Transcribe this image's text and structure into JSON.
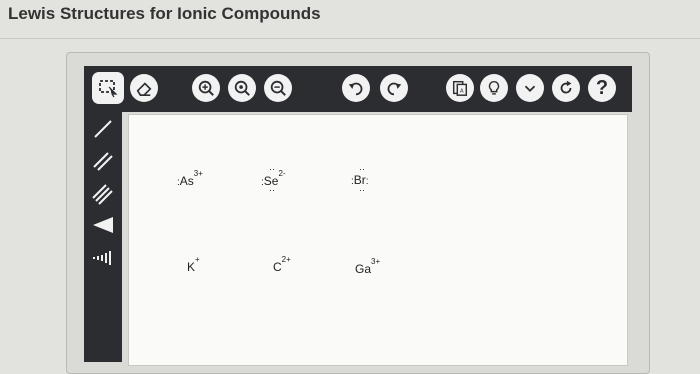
{
  "page": {
    "title": "Lewis Structures for Ionic Compounds"
  },
  "toolbar": {
    "buttons": [
      {
        "name": "select-tool",
        "icon": "lasso-select-icon"
      },
      {
        "name": "eraser-tool",
        "icon": "eraser-icon"
      },
      {
        "name": "zoom-fit",
        "icon": "zoom-plus-icon"
      },
      {
        "name": "zoom-reset",
        "icon": "zoom-in-icon"
      },
      {
        "name": "zoom-out",
        "icon": "zoom-out-icon"
      },
      {
        "name": "undo",
        "icon": "undo-icon"
      },
      {
        "name": "redo",
        "icon": "redo-icon"
      },
      {
        "name": "template",
        "icon": "template-icon"
      },
      {
        "name": "hint",
        "icon": "lightbulb-icon"
      },
      {
        "name": "more",
        "icon": "chevron-down-icon"
      },
      {
        "name": "refresh",
        "icon": "refresh-icon"
      },
      {
        "name": "help",
        "icon": "question-icon",
        "label": "?"
      }
    ]
  },
  "side_tools": [
    {
      "name": "single-bond",
      "icon": "single-bond-icon"
    },
    {
      "name": "double-bond",
      "icon": "double-bond-icon"
    },
    {
      "name": "triple-bond",
      "icon": "triple-bond-icon"
    },
    {
      "name": "wedge-bond",
      "icon": "wedge-bond-icon"
    },
    {
      "name": "hash-bond",
      "icon": "hash-bond-icon"
    }
  ],
  "atoms": [
    {
      "symbol": "As",
      "charge": "3+",
      "left_dots": ":"
    },
    {
      "symbol": "Se",
      "charge": "2-",
      "left_dots": ":",
      "top_dots": "··",
      "bottom_dots": "··"
    },
    {
      "symbol": "Br",
      "charge": "",
      "left_dots": ":",
      "right_dots": ":",
      "top_dots": "··",
      "bottom_dots": "··"
    },
    {
      "symbol": "K",
      "charge": "+"
    },
    {
      "symbol": "C",
      "charge": "2+"
    },
    {
      "symbol": "Ga",
      "charge": "3+"
    }
  ],
  "colors": {
    "toolbar_bg": "#2b2d31",
    "button_bg": "#f2f2f2",
    "canvas_bg": "#fafaf9",
    "page_bg": "#e2e2df"
  }
}
